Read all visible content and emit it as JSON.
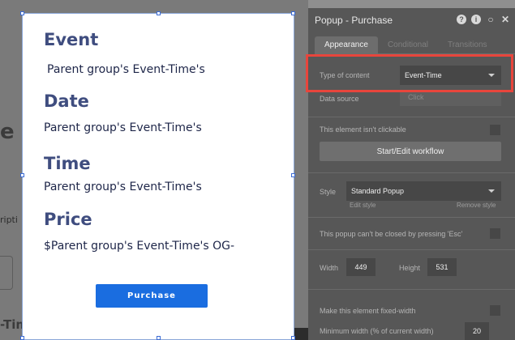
{
  "background": {
    "partial_heading": "e Ev",
    "partial_text": "ripti",
    "partial_bottom": "-Tim"
  },
  "popup": {
    "sections": [
      {
        "heading": "Event",
        "value": "Parent group's Event-Time's"
      },
      {
        "heading": "Date",
        "value": "Parent group's Event-Time's"
      },
      {
        "heading": "Time",
        "value": "Parent group's Event-Time's"
      },
      {
        "heading": "Price",
        "value": "$Parent group's Event-Time's OG-"
      }
    ],
    "purchase_label": "Purchase"
  },
  "editor": {
    "title": "Popup - Purchase",
    "icons": [
      "help-icon",
      "info-icon",
      "comment-icon",
      "close-icon"
    ],
    "tabs": [
      "Appearance",
      "Conditional",
      "Transitions"
    ],
    "type_of_content_label": "Type of content",
    "type_of_content_value": "Event-Time",
    "data_source_label": "Data source",
    "data_source_placeholder": "Click",
    "not_clickable_label": "This element isn't clickable",
    "workflow_button": "Start/Edit workflow",
    "style_label": "Style",
    "style_value": "Standard Popup",
    "edit_style": "Edit style",
    "remove_style": "Remove style",
    "esc_label": "This popup can't be closed by pressing 'Esc'",
    "width_label": "Width",
    "width_value": "449",
    "height_label": "Height",
    "height_value": "531",
    "fixed_width_label": "Make this element fixed-width",
    "min_width_label": "Minimum width (% of current width)",
    "min_width_value": "20"
  },
  "colors": {
    "accent": "#1a6de0",
    "highlight": "#e8453c",
    "heading": "#3f4d7f"
  }
}
